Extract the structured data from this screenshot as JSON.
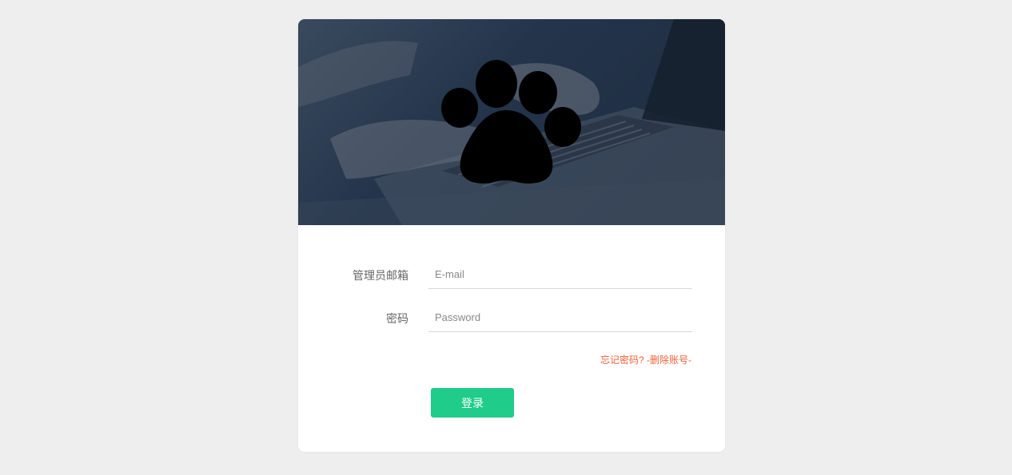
{
  "header": {
    "logo_icon": "paw-icon",
    "background": "laptop-typing-photo"
  },
  "form": {
    "email_label": "管理员邮箱",
    "email_placeholder": "E-mail",
    "email_value": "",
    "password_label": "密码",
    "password_placeholder": "Password",
    "password_value": ""
  },
  "links": {
    "forgot_password": "忘记密码?",
    "separator": " ",
    "delete_account": "-删除账号-"
  },
  "actions": {
    "login_label": "登录"
  },
  "colors": {
    "page_bg": "#eeeeee",
    "hero_overlay": "#1f2e42",
    "link": "#f0623a",
    "primary": "#1fcc8a"
  }
}
